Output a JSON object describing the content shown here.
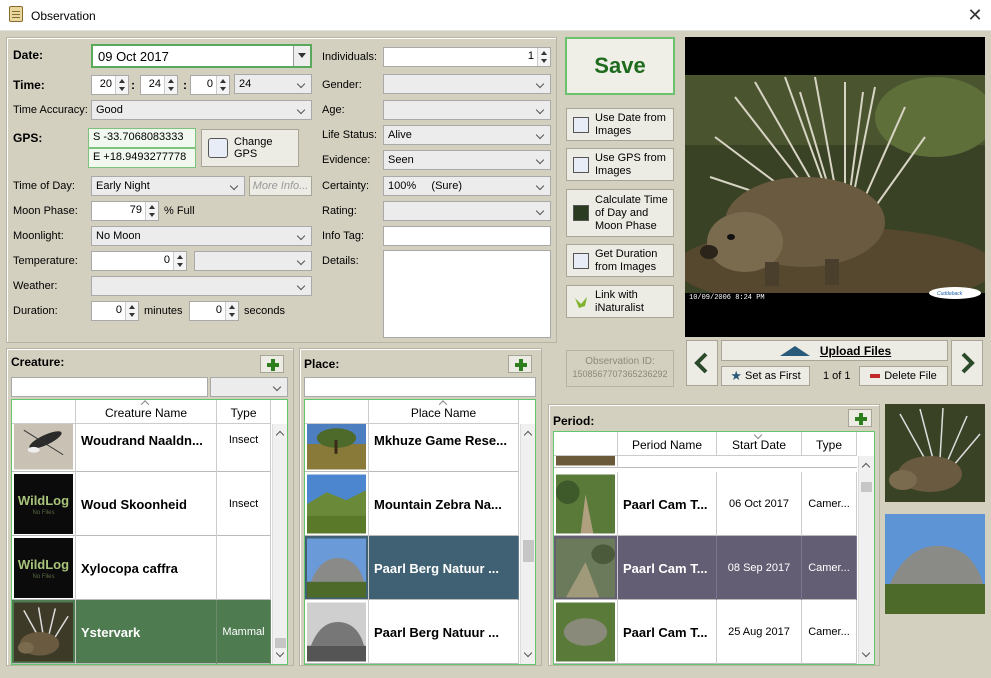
{
  "window": {
    "title": "Observation",
    "close_glyph": "✕"
  },
  "form": {
    "date_label": "Date:",
    "date_value": "09 Oct 2017",
    "time_label": "Time:",
    "time_hour": "20",
    "time_minute": "24",
    "time_second": "0",
    "time_format": "24",
    "time_sep": ":",
    "time_accuracy_label": "Time Accuracy:",
    "time_accuracy_value": "Good",
    "gps_label": "GPS:",
    "gps_lat": "S -33.7068083333",
    "gps_lon": "E +18.9493277778",
    "change_gps_label": "Change GPS",
    "time_of_day_label": "Time of Day:",
    "time_of_day_value": "Early Night",
    "more_info_label": "More Info...",
    "moon_phase_label": "Moon Phase:",
    "moon_phase_value": "79",
    "moon_phase_unit": "% Full",
    "moonlight_label": "Moonlight:",
    "moonlight_value": "No Moon",
    "temperature_label": "Temperature:",
    "temperature_value": "0",
    "weather_label": "Weather:",
    "duration_label": "Duration:",
    "duration_minutes": "0",
    "minutes_label": "minutes",
    "duration_seconds": "0",
    "seconds_label": "seconds",
    "individuals_label": "Individuals:",
    "individuals_value": "1",
    "gender_label": "Gender:",
    "age_label": "Age:",
    "life_status_label": "Life Status:",
    "life_status_value": "Alive",
    "evidence_label": "Evidence:",
    "evidence_value": "Seen",
    "certainty_label": "Certainty:",
    "certainty_value": "100%     (Sure)",
    "rating_label": "Rating:",
    "info_tag_label": "Info Tag:",
    "details_label": "Details:"
  },
  "actions": {
    "save": "Save",
    "use_date": "Use Date from Images",
    "use_gps": "Use GPS from Images",
    "calc_time": "Calculate Time of Day and Moon Phase",
    "get_duration": "Get Duration from Images",
    "inaturalist": "Link with iNaturalist",
    "observation_id_label": "Observation ID:",
    "observation_id": "1508567707365236292"
  },
  "media": {
    "image_stamp_date": "10/09/2006  8:24 PM",
    "upload_label": "Upload Files",
    "set_first_label": "Set as First",
    "counter": "1 of 1",
    "delete_label": "Delete File",
    "brand_mark": "Cuddeback"
  },
  "creature": {
    "title": "Creature:",
    "col_name": "Creature Name",
    "col_type": "Type",
    "rows": [
      {
        "name": "Woudrand Naaldn...",
        "type": "Insect",
        "thumb": "insect"
      },
      {
        "name": "Woud Skoonheid",
        "type": "Insect",
        "thumb": "wildlog"
      },
      {
        "name": "Xylocopa caffra",
        "type": "",
        "thumb": "wildlog"
      },
      {
        "name": "Ystervark",
        "type": "Mammal",
        "thumb": "porcupine"
      }
    ],
    "wildlog_text": "WildLog",
    "wildlog_sub": "No Files"
  },
  "place": {
    "title": "Place:",
    "col_name": "Place Name",
    "rows": [
      {
        "name": "Mkhuze Game Rese...",
        "thumb": "savanna"
      },
      {
        "name": "Mountain Zebra Na...",
        "thumb": "hills"
      },
      {
        "name": "Paarl Berg Natuur ...",
        "thumb": "rock"
      },
      {
        "name": "Paarl Berg Natuur ...",
        "thumb": "rockbw"
      }
    ]
  },
  "period": {
    "title": "Period:",
    "col_name": "Period Name",
    "col_start": "Start Date",
    "col_type": "Type",
    "rows": [
      {
        "name": "Paarl Cam T...",
        "start": "06 Oct 2017",
        "type": "Camer...",
        "thumb": "trail"
      },
      {
        "name": "Paarl Cam T...",
        "start": "08 Sep 2017",
        "type": "Camer...",
        "thumb": "trail2"
      },
      {
        "name": "Paarl Cam T...",
        "start": "25 Aug 2017",
        "type": "Camer...",
        "thumb": "trail3"
      }
    ]
  },
  "colors": {
    "save_green": "#1e6b1e",
    "selection_green": "#4e7b4f",
    "selection_blue": "#3f6173",
    "selection_purple": "#635e73"
  }
}
